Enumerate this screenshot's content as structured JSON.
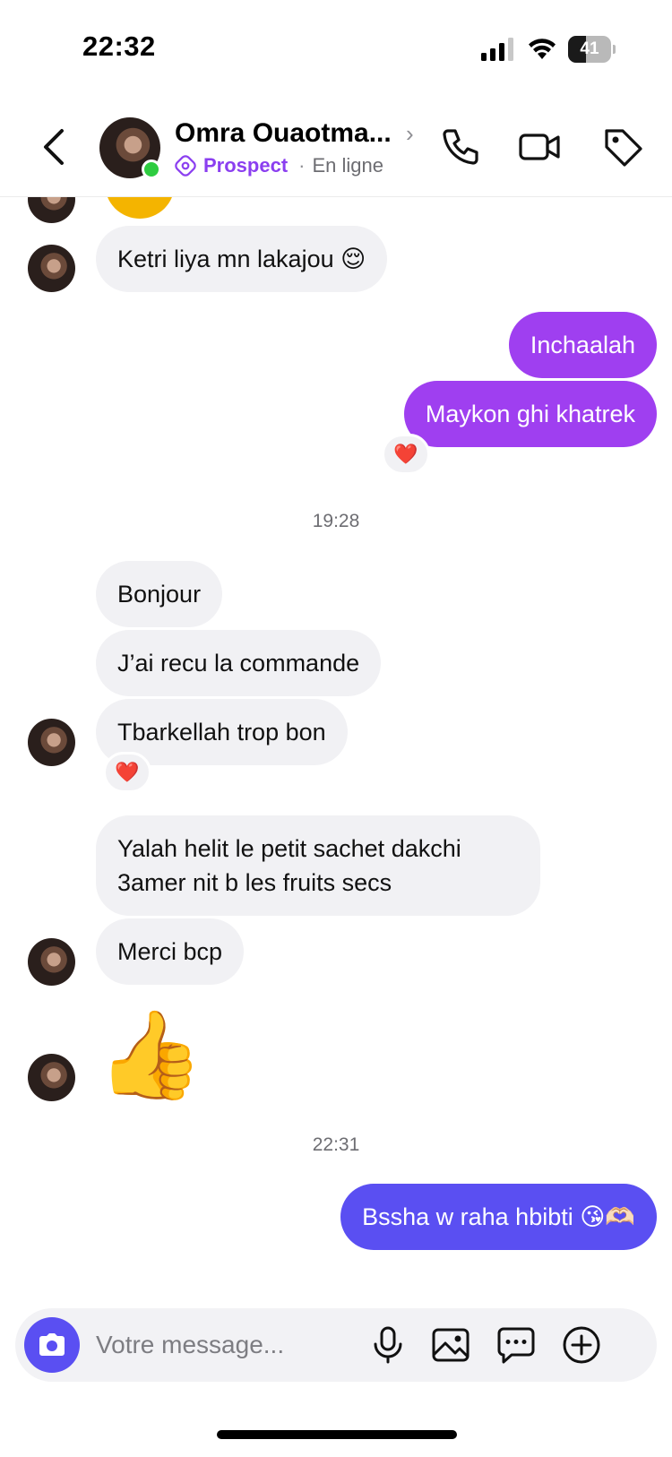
{
  "status_bar": {
    "time": "22:32",
    "battery_level": "41"
  },
  "header": {
    "contact_name": "Omra Ouaotma...",
    "tag_label": "Prospect",
    "presence_separator": "·",
    "presence": "En ligne",
    "online": true
  },
  "messages": [
    {
      "direction": "in",
      "text": "Ketri liya mn lakajou 😌"
    },
    {
      "direction": "out",
      "text": "Inchaalah"
    },
    {
      "direction": "out",
      "text": "Maykon ghi khatrek",
      "reaction": "❤️"
    },
    {
      "type": "timestamp",
      "text": "19:28"
    },
    {
      "direction": "in",
      "text": "Bonjour"
    },
    {
      "direction": "in",
      "text": "J’ai recu la commande"
    },
    {
      "direction": "in",
      "text": "Tbarkellah trop bon",
      "reaction": "❤️"
    },
    {
      "direction": "in",
      "text": "Yalah helit le petit sachet dakchi 3amer nit b les fruits secs"
    },
    {
      "direction": "in",
      "text": "Merci bcp"
    },
    {
      "direction": "in",
      "text": "👍"
    },
    {
      "type": "timestamp",
      "text": "22:31"
    },
    {
      "direction": "out",
      "text": "Bssha w raha hbibti 😘🫶🏻"
    }
  ],
  "composer": {
    "placeholder": "Votre message..."
  },
  "colors": {
    "accent_purple": "#9f3ff0",
    "accent_blue": "#5a4ff2",
    "incoming_bubble": "#f1f1f4",
    "online_green": "#2ecc40"
  },
  "icons": [
    "back-chevron-icon",
    "phone-icon",
    "video-camera-icon",
    "tag-icon",
    "camera-icon",
    "microphone-icon",
    "image-icon",
    "chat-bubble-icon",
    "plus-circle-icon"
  ]
}
